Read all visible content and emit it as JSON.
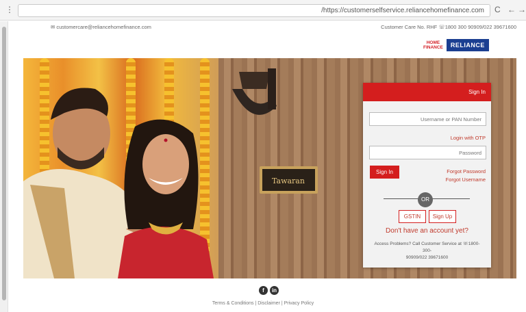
{
  "browser": {
    "menu_glyph": "⋮",
    "url": "https://customerselfservice.reliancehomefinance.com/",
    "reload_glyph": "C",
    "back_glyph": "←",
    "forward_glyph": "→",
    "lock_glyph": "🗋"
  },
  "topbar": {
    "email": "✉ customercare@reliancehomefinance.com",
    "care": "Customer Care No. RHF ☏1800 300 90909/022 39671600"
  },
  "logo": {
    "line1": "HOME",
    "line2": "FINANCE",
    "brand": "RELIANCE"
  },
  "hero": {
    "nameplate": "Tawaran"
  },
  "signin": {
    "title": "Sign In",
    "username_placeholder": "Username or PAN Number",
    "otp_link": "Login with OTP",
    "password_placeholder": "Password",
    "forgot_password": "Forgot Password",
    "forgot_username": "Forgot Username",
    "signin_button": "Sign In",
    "or_text": "OR",
    "signup_button": "Sign Up",
    "gstin_button": "GSTIN",
    "no_account": "Don't have an account yet?",
    "help_line1": "Access Problems? Call Customer Service at ☏1800-300-",
    "help_line2": "90909/022 39671600"
  },
  "footer": {
    "social_icons": [
      "f",
      "in"
    ],
    "links": "Terms & Conditions | Disclaimer | Privacy Policy"
  }
}
